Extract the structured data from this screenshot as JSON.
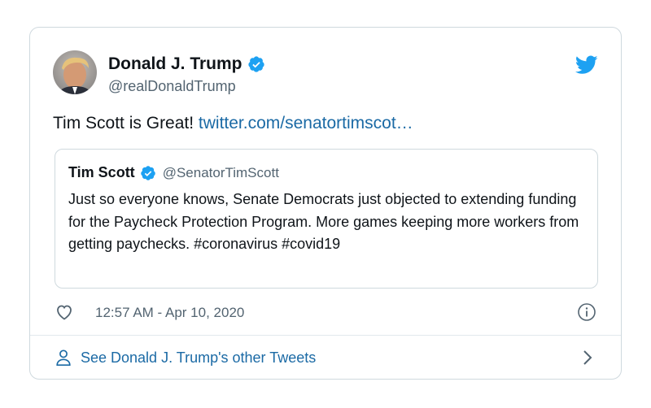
{
  "tweet": {
    "author_name": "Donald J. Trump",
    "author_handle": "@realDonaldTrump",
    "text": "Tim Scott is Great! ",
    "link_text": "twitter.com/senatortimscot…",
    "timestamp": "12:57 AM - Apr 10, 2020"
  },
  "quoted_tweet": {
    "author_name": "Tim Scott",
    "author_handle": "@SenatorTimScott",
    "text": "Just so everyone knows, Senate Democrats just objected to extending funding for the Paycheck Protection Program. More games keeping more workers from getting paychecks. #coronavirus #covid19"
  },
  "footer": {
    "label": "See Donald J. Trump's other Tweets"
  },
  "icons": {
    "verified": "verified-badge-icon",
    "twitter": "twitter-bird-icon",
    "like": "heart-icon",
    "info": "info-icon",
    "profile": "person-icon",
    "chevron": "chevron-right-icon"
  },
  "colors": {
    "brand": "#1da1f2",
    "link": "#1b6aa5",
    "border": "#cfd9de",
    "muted_text": "#536471",
    "primary_text": "#0f1419"
  }
}
